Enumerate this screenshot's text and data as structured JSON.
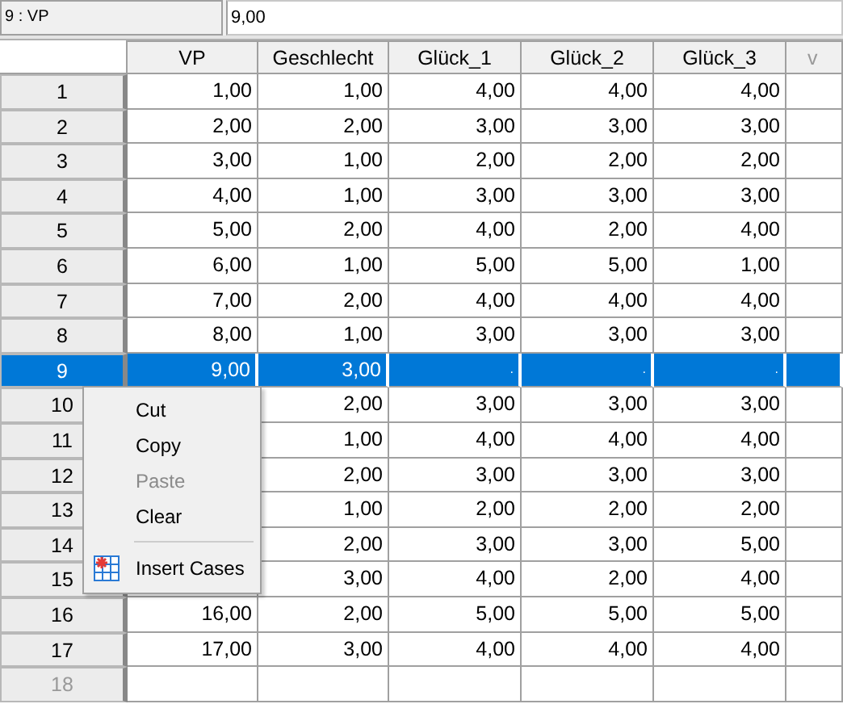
{
  "cell_reference": "9 : VP",
  "cell_value": "9,00",
  "columns": [
    "VP",
    "Geschlecht",
    "Glück_1",
    "Glück_2",
    "Glück_3",
    "v"
  ],
  "rows": [
    {
      "case": "1",
      "selected": false,
      "inactive": false,
      "cells": [
        "1,00",
        "1,00",
        "4,00",
        "4,00",
        "4,00"
      ]
    },
    {
      "case": "2",
      "selected": false,
      "inactive": false,
      "cells": [
        "2,00",
        "2,00",
        "3,00",
        "3,00",
        "3,00"
      ]
    },
    {
      "case": "3",
      "selected": false,
      "inactive": false,
      "cells": [
        "3,00",
        "1,00",
        "2,00",
        "2,00",
        "2,00"
      ]
    },
    {
      "case": "4",
      "selected": false,
      "inactive": false,
      "cells": [
        "4,00",
        "1,00",
        "3,00",
        "3,00",
        "3,00"
      ]
    },
    {
      "case": "5",
      "selected": false,
      "inactive": false,
      "cells": [
        "5,00",
        "2,00",
        "4,00",
        "2,00",
        "4,00"
      ]
    },
    {
      "case": "6",
      "selected": false,
      "inactive": false,
      "cells": [
        "6,00",
        "1,00",
        "5,00",
        "5,00",
        "1,00"
      ]
    },
    {
      "case": "7",
      "selected": false,
      "inactive": false,
      "cells": [
        "7,00",
        "2,00",
        "4,00",
        "4,00",
        "4,00"
      ]
    },
    {
      "case": "8",
      "selected": false,
      "inactive": false,
      "cells": [
        "8,00",
        "1,00",
        "3,00",
        "3,00",
        "3,00"
      ]
    },
    {
      "case": "9",
      "selected": true,
      "inactive": false,
      "cells": [
        "9,00",
        "3,00",
        ".",
        ".",
        "."
      ]
    },
    {
      "case": "10",
      "selected": false,
      "inactive": false,
      "cells": [
        null,
        "2,00",
        "3,00",
        "3,00",
        "3,00"
      ]
    },
    {
      "case": "11",
      "selected": false,
      "inactive": false,
      "cells": [
        null,
        "1,00",
        "4,00",
        "4,00",
        "4,00"
      ]
    },
    {
      "case": "12",
      "selected": false,
      "inactive": false,
      "cells": [
        null,
        "2,00",
        "3,00",
        "3,00",
        "3,00"
      ]
    },
    {
      "case": "13",
      "selected": false,
      "inactive": false,
      "cells": [
        null,
        "1,00",
        "2,00",
        "2,00",
        "2,00"
      ]
    },
    {
      "case": "14",
      "selected": false,
      "inactive": false,
      "cells": [
        null,
        "2,00",
        "3,00",
        "3,00",
        "5,00"
      ]
    },
    {
      "case": "15",
      "selected": false,
      "inactive": false,
      "cells": [
        null,
        "3,00",
        "4,00",
        "2,00",
        "4,00"
      ]
    },
    {
      "case": "16",
      "selected": false,
      "inactive": false,
      "cells": [
        "16,00",
        "2,00",
        "5,00",
        "5,00",
        "5,00"
      ]
    },
    {
      "case": "17",
      "selected": false,
      "inactive": false,
      "cells": [
        "17,00",
        "3,00",
        "4,00",
        "4,00",
        "4,00"
      ]
    },
    {
      "case": "18",
      "selected": false,
      "inactive": true,
      "cells": []
    }
  ],
  "context_menu": [
    {
      "kind": "item",
      "label": "Cut",
      "disabled": false
    },
    {
      "kind": "item",
      "label": "Copy",
      "disabled": false
    },
    {
      "kind": "item",
      "label": "Paste",
      "disabled": true
    },
    {
      "kind": "item",
      "label": "Clear",
      "disabled": false
    },
    {
      "kind": "separator"
    },
    {
      "kind": "icon-item",
      "label": "Insert Cases",
      "disabled": false
    }
  ]
}
